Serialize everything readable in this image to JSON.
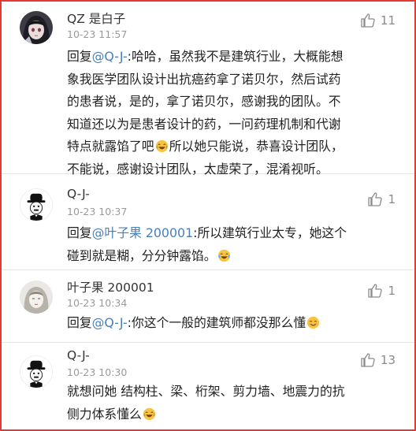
{
  "comments": [
    {
      "name": "QZ 是白子",
      "time": "10-23 11:57",
      "likes": "11",
      "avatar": "anime-girl-avatar",
      "reply_prefix": "回复",
      "mention": "@Q-J-",
      "lines": [
        ":哈哈，虽然我不是建筑行业，大概能想",
        "象我医学团队设计出抗癌药拿了诺贝尔，然后试药",
        "的患者说，是的，拿了诺贝尔，感谢我的团队。不",
        "知道还以为是患者设计的药，一问药理机制和代谢",
        "特点就露馅了吧",
        "所以她只能说，恭喜设计团队，",
        "不能说，感谢设计团队，太虚荣了，混淆视听。"
      ]
    },
    {
      "name": "Q-J-",
      "time": "10-23 10:37",
      "likes": "1",
      "avatar": "chaplin-avatar",
      "reply_prefix": "回复",
      "mention": "@叶子果 200001",
      "lines": [
        ":所以建筑行业太专，她这个",
        "碰到就是糊，分分钟露馅。"
      ]
    },
    {
      "name": "叶子果 200001",
      "time": "10-23 10:34",
      "likes": "1",
      "avatar": "sketch-portrait-avatar",
      "reply_prefix": "回复",
      "mention": "@Q-J-",
      "lines": [
        ":你这个一般的建筑师都没那么懂"
      ]
    },
    {
      "name": "Q-J-",
      "time": "10-23 10:30",
      "likes": "13",
      "avatar": "chaplin-avatar",
      "lines": [
        "就想问她 结构柱、梁、桁架、剪力墙、地震力的抗",
        "侧力体系懂么"
      ]
    }
  ],
  "colors": {
    "border": "#e53935",
    "mention": "#4a7fb5",
    "meta": "#9a9a9a"
  },
  "icons": [
    "thumbs-up-icon",
    "laughing-emoji-icon",
    "smile-emoji-icon"
  ]
}
